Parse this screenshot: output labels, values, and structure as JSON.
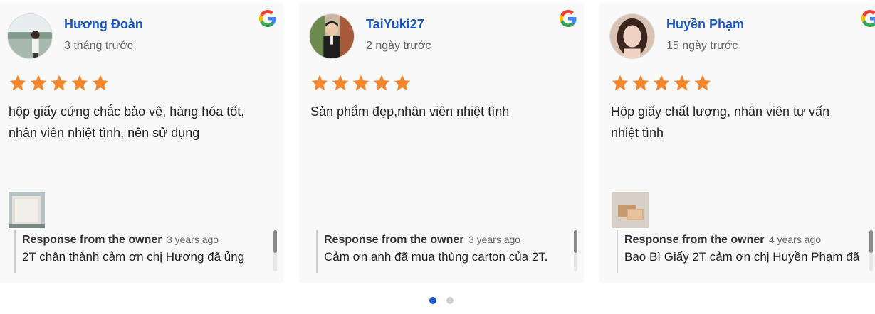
{
  "reviews": [
    {
      "name": "Hương Đoàn",
      "date": "3 tháng trước",
      "rating": 5,
      "text_lines": [
        "hộp giấy cứng chắc bảo vệ, hàng hóa tốt,",
        "nhân viên nhiệt tình, nên sử dụng"
      ],
      "response_label": "Response from the owner",
      "response_time": "3 years ago",
      "response_text": "2T chân thành cảm ơn chị Hương đã ủng",
      "has_photo": true
    },
    {
      "name": "TaiYuki27",
      "date": "2 ngày trước",
      "rating": 5,
      "text_lines": [
        "Sản phẩm đẹp,nhân viên nhiệt tình"
      ],
      "response_label": "Response from the owner",
      "response_time": "3 years ago",
      "response_text": "Cảm ơn anh đã mua thùng carton của 2T.",
      "has_photo": false
    },
    {
      "name": "Huyền Phạm",
      "date": "15 ngày trước",
      "rating": 5,
      "text_lines": [
        "Hộp giấy chất lượng, nhân viên tư vấn",
        "nhiệt tình"
      ],
      "response_label": "Response from the owner",
      "response_time": "4 years ago",
      "response_text": "Bao Bì Giấy 2T cảm ơn chị Huyền Phạm đã",
      "has_photo": true
    }
  ],
  "pagination": {
    "pages": 2,
    "active": 1
  },
  "icons": {
    "source": "google-icon",
    "star": "star-icon"
  },
  "colors": {
    "name": "#1a56c5",
    "star": "#f5862b",
    "active_dot": "#1a56c5"
  }
}
